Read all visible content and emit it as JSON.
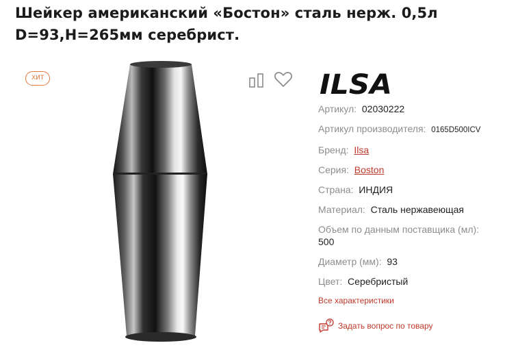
{
  "product": {
    "title_line1": "Шейкер американский «Бостон» сталь нерж. 0,5л",
    "title_line2": "D=93,H=265мм серебрист.",
    "badge": "хит",
    "brand_logo_text": "ILSA"
  },
  "specs": [
    {
      "label": "Артикул:",
      "value": "02030222"
    },
    {
      "label": "Артикул производителя:",
      "value": "0165D500ICV"
    },
    {
      "label": "Бренд:",
      "value": "Ilsa"
    },
    {
      "label": "Серия:",
      "value": "Boston"
    },
    {
      "label": "Страна:",
      "value": "ИНДИЯ"
    },
    {
      "label": "Материал:",
      "value": "Сталь нержавеющая"
    },
    {
      "label": "Объем по данным поставщика (мл):",
      "value": "500"
    },
    {
      "label": "Диаметр (мм):",
      "value": "93"
    },
    {
      "label": "Цвет:",
      "value": "Серебристый"
    }
  ],
  "links": {
    "all_specs": "Все характеристики",
    "ask_question": "Задать вопрос по товару"
  },
  "icons": {
    "compare": "compare-icon",
    "favorite": "heart-icon",
    "ask": "chat-question-icon"
  },
  "colors": {
    "accent": "#c0392b",
    "badge": "#e0783c",
    "label": "#8d8d8d"
  }
}
